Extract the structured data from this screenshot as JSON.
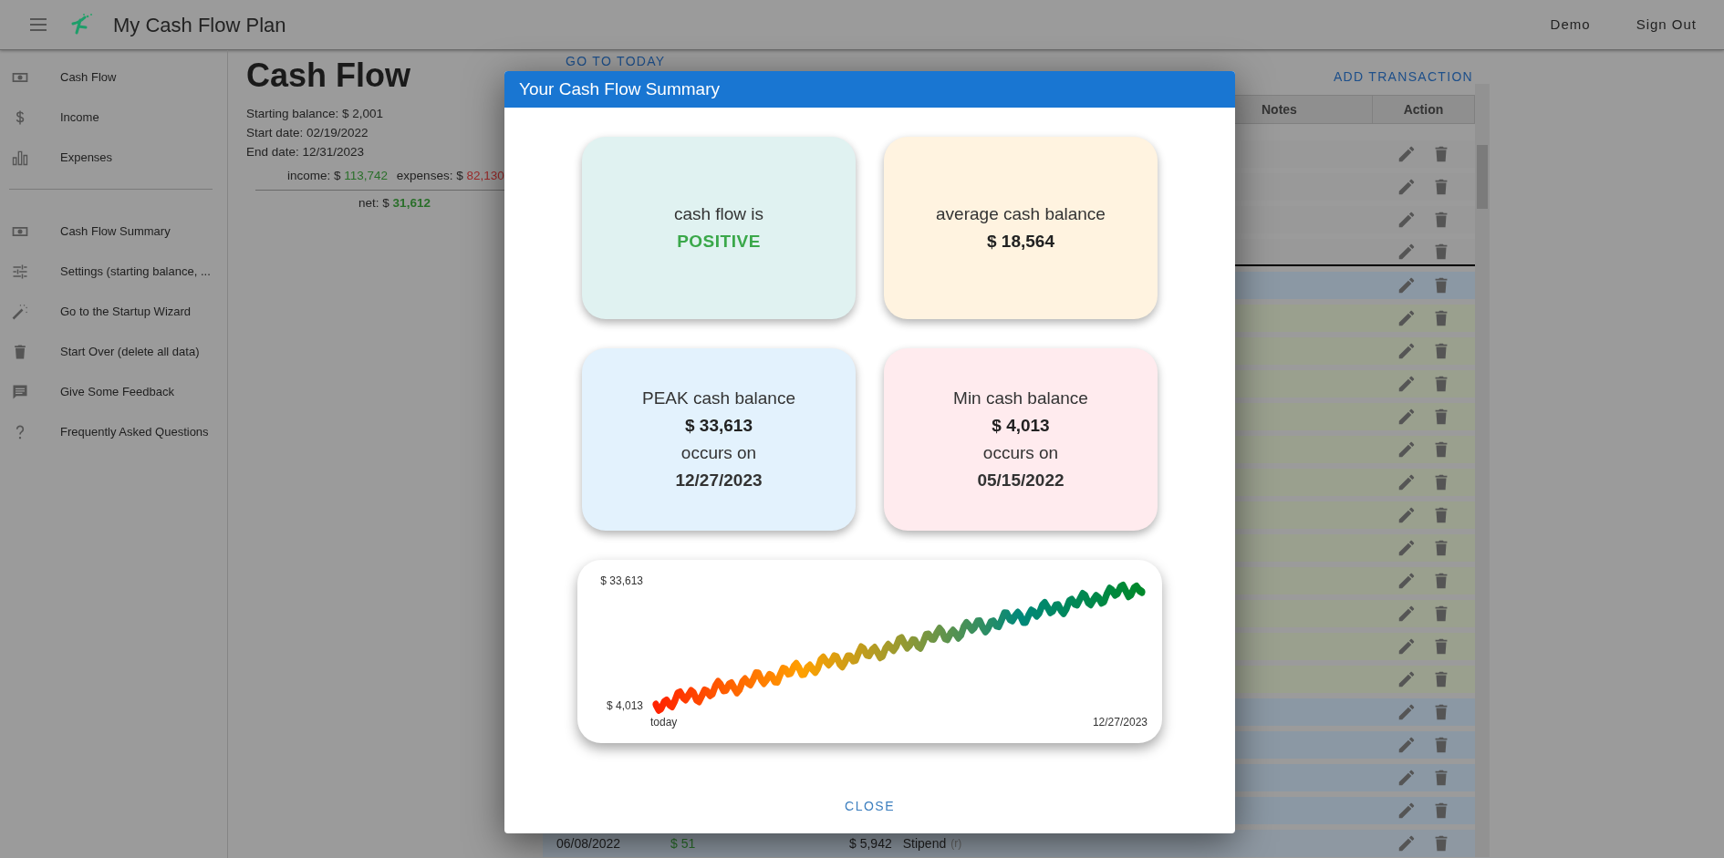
{
  "app_bar": {
    "title": "My Cash Flow Plan",
    "links": [
      "Demo",
      "Sign Out"
    ]
  },
  "sidebar": {
    "sections": [
      {
        "items": [
          {
            "label": "Cash Flow"
          },
          {
            "label": "Income"
          },
          {
            "label": "Expenses"
          }
        ]
      },
      {
        "items": [
          {
            "label": "Cash Flow Summary"
          },
          {
            "label": "Settings (starting balance, ..."
          },
          {
            "label": "Go to the Startup Wizard"
          },
          {
            "label": "Start Over (delete all data)"
          },
          {
            "label": "Give Some Feedback"
          },
          {
            "label": "Frequently Asked Questions"
          }
        ]
      }
    ]
  },
  "page": {
    "title": "Cash Flow",
    "facts": [
      "Starting balance: $ 2,001",
      "Start date: 02/19/2022",
      "End date: 12/31/2023"
    ],
    "totals": {
      "income_label": "income: $",
      "income": "113,742",
      "expenses_label": "expenses: $",
      "expenses": "82,130",
      "net_label": "net: $",
      "net": "31,612"
    },
    "go_to_today": "GO TO TODAY",
    "add_transaction": "ADD TRANSACTION"
  },
  "table": {
    "columns": [
      "Notes",
      "Action"
    ],
    "rows": [
      {
        "color": "#999999",
        "border_below": false
      },
      {
        "color": "#999999",
        "border_below": false
      },
      {
        "color": "#999999",
        "border_below": false
      },
      {
        "color": "#999999",
        "border_below": true
      },
      {
        "color": "#8b98a4",
        "border_below": false
      },
      {
        "color": "#9aa08e",
        "border_below": false
      },
      {
        "color": "#9aa08e",
        "border_below": false
      },
      {
        "color": "#9aa08e",
        "border_below": false
      },
      {
        "color": "#9aa08e",
        "border_below": false
      },
      {
        "color": "#9aa08e",
        "border_below": false
      },
      {
        "color": "#9aa08e",
        "border_below": false
      },
      {
        "color": "#9aa08e",
        "border_below": false
      },
      {
        "color": "#9aa08e",
        "border_below": false
      },
      {
        "color": "#9aa08e",
        "border_below": false
      },
      {
        "color": "#9aa08e",
        "border_below": false
      },
      {
        "color": "#9aa08e",
        "border_below": false
      },
      {
        "color": "#9aa08e",
        "border_below": false
      },
      {
        "color": "#8b98a4",
        "border_below": false
      },
      {
        "color": "#8b98a4",
        "border_below": false
      },
      {
        "color": "#8b98a4",
        "border_below": false
      },
      {
        "color": "#8b98a4",
        "border_below": false
      },
      {
        "color": "#8e98a2",
        "border_below": false,
        "date": "06/08/2022",
        "income": "$ 51",
        "balance": "$ 5,942",
        "note": "Stipend",
        "note_tag": "(r)"
      }
    ]
  },
  "dialog": {
    "title": "Your Cash Flow Summary",
    "cards": [
      {
        "kind": "status",
        "color": "#e0f2f1",
        "label": "cash flow is",
        "value": "POSITIVE"
      },
      {
        "kind": "amount",
        "color": "#fff3e0",
        "label": "average cash balance",
        "value": "$ 18,564"
      },
      {
        "kind": "amount",
        "color": "#e3f2fd",
        "label": "PEAK cash balance",
        "value": "$ 33,613",
        "date_label": "occurs on",
        "date": "12/27/2023"
      },
      {
        "kind": "amount",
        "color": "#ffebee",
        "label": "Min cash balance",
        "value": "$ 4,013",
        "date_label": "occurs on",
        "date": "05/15/2022"
      }
    ],
    "chart": {
      "y_max": "$ 33,613",
      "y_min": "$ 4,013",
      "x_start": "today",
      "x_end": "12/27/2023"
    },
    "close": "CLOSE"
  }
}
